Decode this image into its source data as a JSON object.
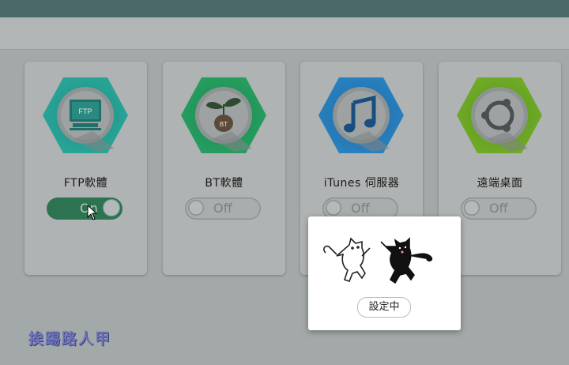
{
  "apps": [
    {
      "name": "FTP軟體",
      "toggle": "On",
      "enabled": true,
      "icon": "ftp-server-icon",
      "color": "#1f8a82"
    },
    {
      "name": "BT軟體",
      "toggle": "Off",
      "enabled": false,
      "icon": "bt-sprout-icon",
      "color": "#1f8a52"
    },
    {
      "name": "iTunes 伺服器",
      "toggle": "Off",
      "enabled": false,
      "icon": "music-note-icon",
      "color": "#1f6fa8"
    },
    {
      "name": "遠端桌面",
      "toggle": "Off",
      "enabled": false,
      "icon": "remote-desktop-icon",
      "color": "#5f9a1f"
    }
  ],
  "modal": {
    "status": "設定中"
  },
  "watermark": "挨踢路人甲"
}
